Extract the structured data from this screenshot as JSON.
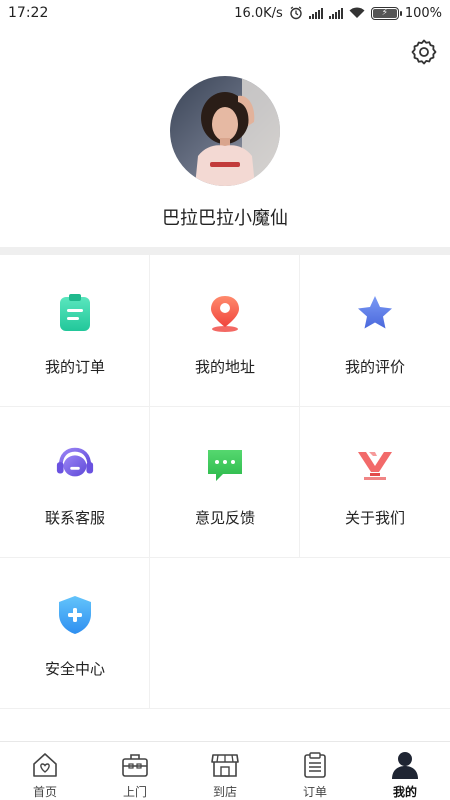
{
  "status_bar": {
    "time": "17:22",
    "network_speed": "16.0K/s",
    "battery_percent": "100%"
  },
  "profile": {
    "username": "巴拉巴拉小魔仙"
  },
  "menu": [
    {
      "label": "我的订单",
      "icon": "order-clipboard-icon",
      "color": "#2ed3a6"
    },
    {
      "label": "我的地址",
      "icon": "location-pin-icon",
      "color": "#f4574c"
    },
    {
      "label": "我的评价",
      "icon": "star-icon",
      "color": "#5a7be8"
    },
    {
      "label": "联系客服",
      "icon": "headset-icon",
      "color": "#7b61e6"
    },
    {
      "label": "意见反馈",
      "icon": "feedback-message-icon",
      "color": "#3cc95a"
    },
    {
      "label": "关于我们",
      "icon": "brand-logo-icon",
      "color": "#f05a5a"
    },
    {
      "label": "安全中心",
      "icon": "shield-plus-icon",
      "color": "#3aa7f2"
    }
  ],
  "tabbar": {
    "items": [
      {
        "label": "首页",
        "icon": "home-heart-icon"
      },
      {
        "label": "上门",
        "icon": "toolbox-icon"
      },
      {
        "label": "到店",
        "icon": "store-icon"
      },
      {
        "label": "订单",
        "icon": "clipboard-list-icon"
      },
      {
        "label": "我的",
        "icon": "person-icon"
      }
    ],
    "active": "我的"
  }
}
